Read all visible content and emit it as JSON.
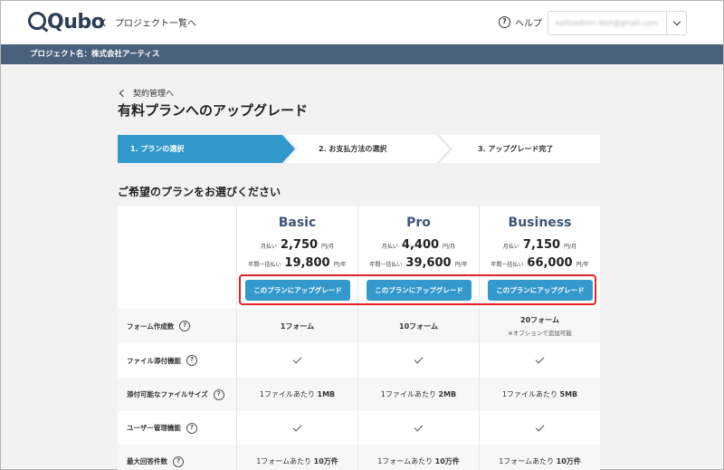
{
  "header": {
    "logo": "Qubo",
    "back_link": "プロジェクト一覧へ",
    "help": "ヘルプ",
    "account_email": "kaitoadmin-test@gmail.com"
  },
  "project_bar": {
    "label": "プロジェクト名：株式会社アーティス"
  },
  "page": {
    "back_link": "契約管理へ",
    "title": "有料プランへのアップグレード"
  },
  "steps": [
    {
      "label": "1. プランの選択",
      "active": true
    },
    {
      "label": "2. お支払方法の選択",
      "active": false
    },
    {
      "label": "3. アップグレード完了",
      "active": false
    }
  ],
  "section_title": "ご希望のプランをお選びください",
  "plans": [
    {
      "name": "Basic",
      "monthly_label": "月払い",
      "monthly_price": "2,750",
      "monthly_unit": "円/月",
      "yearly_label": "年間一括払い",
      "yearly_price": "19,800",
      "yearly_unit": "円/年",
      "button": "このプランにアップグレード"
    },
    {
      "name": "Pro",
      "monthly_label": "月払い",
      "monthly_price": "4,400",
      "monthly_unit": "円/月",
      "yearly_label": "年間一括払い",
      "yearly_price": "39,600",
      "yearly_unit": "円/年",
      "button": "このプランにアップグレード"
    },
    {
      "name": "Business",
      "monthly_label": "月払い",
      "monthly_price": "7,150",
      "monthly_unit": "円/月",
      "yearly_label": "年間一括払い",
      "yearly_price": "66,000",
      "yearly_unit": "円/年",
      "button": "このプランにアップグレード"
    }
  ],
  "features": [
    {
      "label": "フォーム作成数",
      "cells": [
        {
          "text": "1フォーム"
        },
        {
          "text": "10フォーム"
        },
        {
          "text": "20フォーム",
          "note": "※オプションで追加可能"
        }
      ]
    },
    {
      "label": "ファイル添付機能",
      "cells": [
        "check",
        "check",
        "check"
      ]
    },
    {
      "label": "添付可能なファイルサイズ",
      "cells": [
        {
          "prefix": "1ファイルあたり",
          "value": "1MB"
        },
        {
          "prefix": "1ファイルあたり",
          "value": "2MB"
        },
        {
          "prefix": "1ファイルあたり",
          "value": "5MB"
        }
      ]
    },
    {
      "label": "ユーザー管理機能",
      "cells": [
        "check",
        "check",
        "check"
      ]
    },
    {
      "label": "最大回答件数",
      "cells": [
        {
          "prefix": "1フォームあたり",
          "value": "10万件"
        },
        {
          "prefix": "1フォームあたり",
          "value": "10万件"
        },
        {
          "prefix": "1フォームあたり",
          "value": "10万件"
        }
      ]
    }
  ],
  "colors": {
    "accent": "#3399cc",
    "project_bar": "#4a617e",
    "plan_name": "#3d5676",
    "highlight": "#e0242b"
  }
}
